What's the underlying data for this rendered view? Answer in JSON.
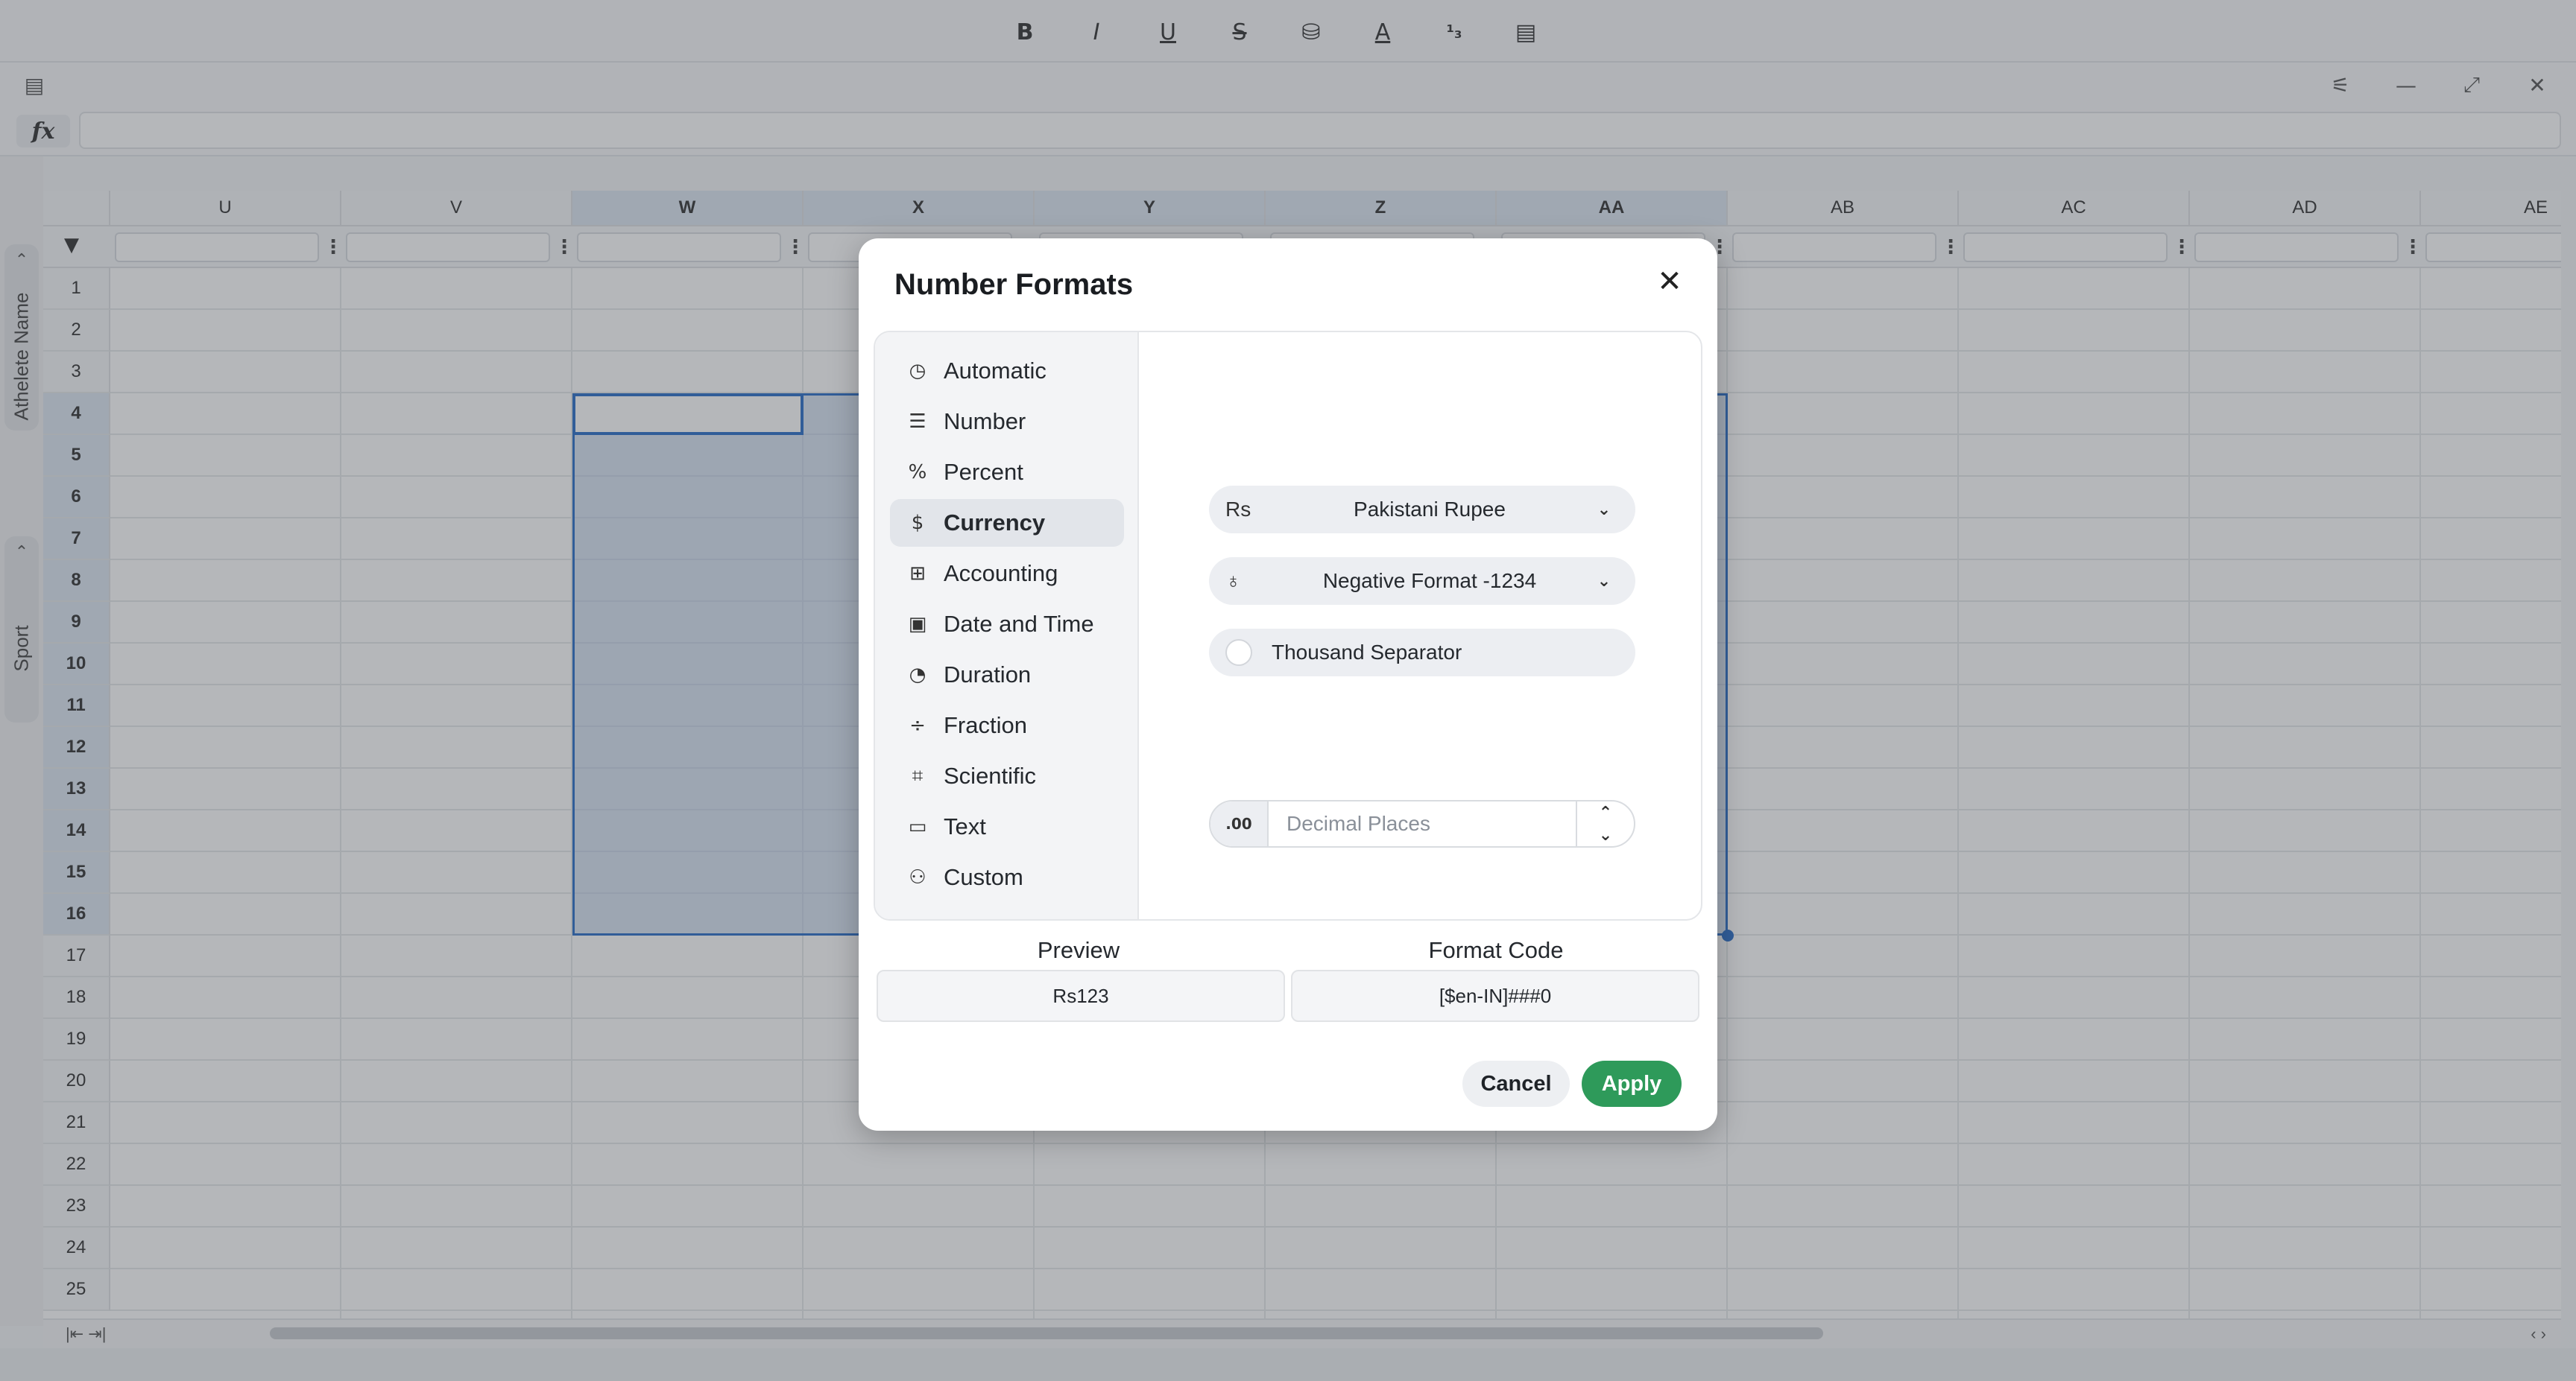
{
  "toolbar": {
    "buttons": [
      {
        "name": "bold-button",
        "glyph": "B"
      },
      {
        "name": "italic-button",
        "glyph": "I"
      },
      {
        "name": "underline-button",
        "glyph": "U"
      },
      {
        "name": "strikethrough-button",
        "glyph": "S"
      },
      {
        "name": "fill-color-button",
        "glyph": "⛁"
      },
      {
        "name": "text-color-button",
        "glyph": "A"
      },
      {
        "name": "number-format-button",
        "glyph": "¹₃"
      },
      {
        "name": "conditional-format-button",
        "glyph": "▤"
      }
    ]
  },
  "formula_bar": {
    "label": "fx",
    "value": ""
  },
  "side_rail": {
    "groups": [
      "Athelete Name",
      "Sport"
    ]
  },
  "grid": {
    "columns": [
      "U",
      "V",
      "W",
      "X",
      "Y",
      "Z",
      "AA",
      "AB",
      "AC",
      "AD",
      "AE"
    ],
    "selected_columns": [
      "W",
      "X",
      "Y",
      "Z",
      "AA"
    ],
    "rows": [
      "1",
      "2",
      "3",
      "4",
      "5",
      "6",
      "7",
      "8",
      "9",
      "10",
      "11",
      "12",
      "13",
      "14",
      "15",
      "16",
      "17",
      "18",
      "19",
      "20",
      "21",
      "22",
      "23",
      "24",
      "25"
    ],
    "selected_rows": [
      "4",
      "5",
      "6",
      "7",
      "8",
      "9",
      "10",
      "11",
      "12",
      "13",
      "14",
      "15",
      "16"
    ]
  },
  "dialog": {
    "title": "Number Formats",
    "close_glyph": "✕",
    "categories": [
      {
        "label": "Automatic",
        "icon": "clock-icon",
        "glyph": "◷"
      },
      {
        "label": "Number",
        "icon": "list-number-icon",
        "glyph": "☰"
      },
      {
        "label": "Percent",
        "icon": "percent-icon",
        "glyph": "%"
      },
      {
        "label": "Currency",
        "icon": "dollar-icon",
        "glyph": "$"
      },
      {
        "label": "Accounting",
        "icon": "accounting-icon",
        "glyph": "⊞"
      },
      {
        "label": "Date and Time",
        "icon": "calendar-icon",
        "glyph": "▣"
      },
      {
        "label": "Duration",
        "icon": "timer-icon",
        "glyph": "◔"
      },
      {
        "label": "Fraction",
        "icon": "fraction-icon",
        "glyph": "÷"
      },
      {
        "label": "Scientific",
        "icon": "scientific-icon",
        "glyph": "⌗"
      },
      {
        "label": "Text",
        "icon": "text-box-icon",
        "glyph": "▭"
      },
      {
        "label": "Custom",
        "icon": "custom-user-icon",
        "glyph": "⚇"
      }
    ],
    "active_category": "Currency",
    "currency": {
      "symbol": "Rs",
      "name": "Pakistani Rupee"
    },
    "negative_format": "Negative Format -1234",
    "thousand_separator": {
      "label": "Thousand Separator",
      "checked": false
    },
    "decimal_places": {
      "icon_text": ".00",
      "placeholder": "Decimal Places",
      "value": ""
    },
    "preview_label": "Preview",
    "preview_value": "Rs123",
    "format_code_label": "Format Code",
    "format_code_value": "[$en-IN]###0",
    "cancel_label": "Cancel",
    "apply_label": "Apply"
  },
  "colors": {
    "accent": "#2a6fc9",
    "apply": "#2e9a5a"
  }
}
